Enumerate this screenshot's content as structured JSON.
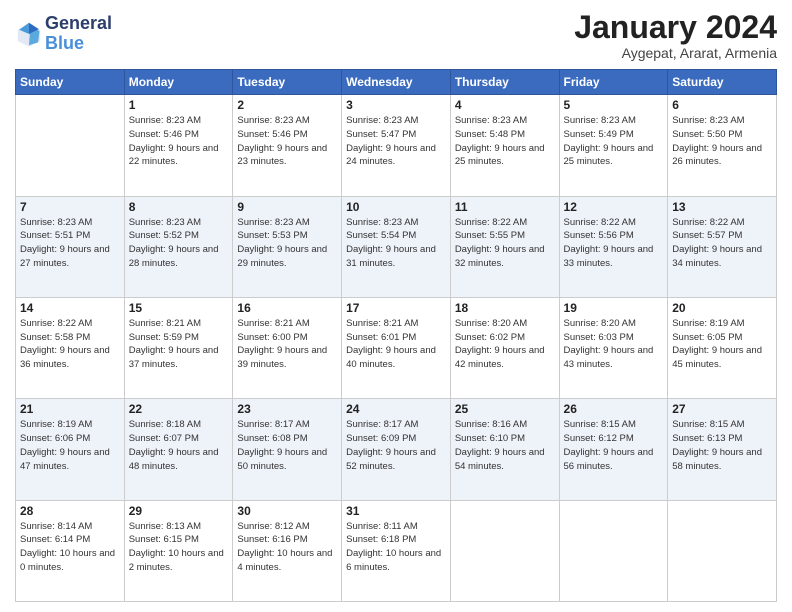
{
  "header": {
    "logo_general": "General",
    "logo_blue": "Blue",
    "month_title": "January 2024",
    "location": "Aygepat, Ararat, Armenia"
  },
  "days_of_week": [
    "Sunday",
    "Monday",
    "Tuesday",
    "Wednesday",
    "Thursday",
    "Friday",
    "Saturday"
  ],
  "weeks": [
    [
      {
        "day": null
      },
      {
        "day": "1",
        "sunrise": "Sunrise: 8:23 AM",
        "sunset": "Sunset: 5:46 PM",
        "daylight": "Daylight: 9 hours and 22 minutes."
      },
      {
        "day": "2",
        "sunrise": "Sunrise: 8:23 AM",
        "sunset": "Sunset: 5:46 PM",
        "daylight": "Daylight: 9 hours and 23 minutes."
      },
      {
        "day": "3",
        "sunrise": "Sunrise: 8:23 AM",
        "sunset": "Sunset: 5:47 PM",
        "daylight": "Daylight: 9 hours and 24 minutes."
      },
      {
        "day": "4",
        "sunrise": "Sunrise: 8:23 AM",
        "sunset": "Sunset: 5:48 PM",
        "daylight": "Daylight: 9 hours and 25 minutes."
      },
      {
        "day": "5",
        "sunrise": "Sunrise: 8:23 AM",
        "sunset": "Sunset: 5:49 PM",
        "daylight": "Daylight: 9 hours and 25 minutes."
      },
      {
        "day": "6",
        "sunrise": "Sunrise: 8:23 AM",
        "sunset": "Sunset: 5:50 PM",
        "daylight": "Daylight: 9 hours and 26 minutes."
      }
    ],
    [
      {
        "day": "7",
        "sunrise": "Sunrise: 8:23 AM",
        "sunset": "Sunset: 5:51 PM",
        "daylight": "Daylight: 9 hours and 27 minutes."
      },
      {
        "day": "8",
        "sunrise": "Sunrise: 8:23 AM",
        "sunset": "Sunset: 5:52 PM",
        "daylight": "Daylight: 9 hours and 28 minutes."
      },
      {
        "day": "9",
        "sunrise": "Sunrise: 8:23 AM",
        "sunset": "Sunset: 5:53 PM",
        "daylight": "Daylight: 9 hours and 29 minutes."
      },
      {
        "day": "10",
        "sunrise": "Sunrise: 8:23 AM",
        "sunset": "Sunset: 5:54 PM",
        "daylight": "Daylight: 9 hours and 31 minutes."
      },
      {
        "day": "11",
        "sunrise": "Sunrise: 8:22 AM",
        "sunset": "Sunset: 5:55 PM",
        "daylight": "Daylight: 9 hours and 32 minutes."
      },
      {
        "day": "12",
        "sunrise": "Sunrise: 8:22 AM",
        "sunset": "Sunset: 5:56 PM",
        "daylight": "Daylight: 9 hours and 33 minutes."
      },
      {
        "day": "13",
        "sunrise": "Sunrise: 8:22 AM",
        "sunset": "Sunset: 5:57 PM",
        "daylight": "Daylight: 9 hours and 34 minutes."
      }
    ],
    [
      {
        "day": "14",
        "sunrise": "Sunrise: 8:22 AM",
        "sunset": "Sunset: 5:58 PM",
        "daylight": "Daylight: 9 hours and 36 minutes."
      },
      {
        "day": "15",
        "sunrise": "Sunrise: 8:21 AM",
        "sunset": "Sunset: 5:59 PM",
        "daylight": "Daylight: 9 hours and 37 minutes."
      },
      {
        "day": "16",
        "sunrise": "Sunrise: 8:21 AM",
        "sunset": "Sunset: 6:00 PM",
        "daylight": "Daylight: 9 hours and 39 minutes."
      },
      {
        "day": "17",
        "sunrise": "Sunrise: 8:21 AM",
        "sunset": "Sunset: 6:01 PM",
        "daylight": "Daylight: 9 hours and 40 minutes."
      },
      {
        "day": "18",
        "sunrise": "Sunrise: 8:20 AM",
        "sunset": "Sunset: 6:02 PM",
        "daylight": "Daylight: 9 hours and 42 minutes."
      },
      {
        "day": "19",
        "sunrise": "Sunrise: 8:20 AM",
        "sunset": "Sunset: 6:03 PM",
        "daylight": "Daylight: 9 hours and 43 minutes."
      },
      {
        "day": "20",
        "sunrise": "Sunrise: 8:19 AM",
        "sunset": "Sunset: 6:05 PM",
        "daylight": "Daylight: 9 hours and 45 minutes."
      }
    ],
    [
      {
        "day": "21",
        "sunrise": "Sunrise: 8:19 AM",
        "sunset": "Sunset: 6:06 PM",
        "daylight": "Daylight: 9 hours and 47 minutes."
      },
      {
        "day": "22",
        "sunrise": "Sunrise: 8:18 AM",
        "sunset": "Sunset: 6:07 PM",
        "daylight": "Daylight: 9 hours and 48 minutes."
      },
      {
        "day": "23",
        "sunrise": "Sunrise: 8:17 AM",
        "sunset": "Sunset: 6:08 PM",
        "daylight": "Daylight: 9 hours and 50 minutes."
      },
      {
        "day": "24",
        "sunrise": "Sunrise: 8:17 AM",
        "sunset": "Sunset: 6:09 PM",
        "daylight": "Daylight: 9 hours and 52 minutes."
      },
      {
        "day": "25",
        "sunrise": "Sunrise: 8:16 AM",
        "sunset": "Sunset: 6:10 PM",
        "daylight": "Daylight: 9 hours and 54 minutes."
      },
      {
        "day": "26",
        "sunrise": "Sunrise: 8:15 AM",
        "sunset": "Sunset: 6:12 PM",
        "daylight": "Daylight: 9 hours and 56 minutes."
      },
      {
        "day": "27",
        "sunrise": "Sunrise: 8:15 AM",
        "sunset": "Sunset: 6:13 PM",
        "daylight": "Daylight: 9 hours and 58 minutes."
      }
    ],
    [
      {
        "day": "28",
        "sunrise": "Sunrise: 8:14 AM",
        "sunset": "Sunset: 6:14 PM",
        "daylight": "Daylight: 10 hours and 0 minutes."
      },
      {
        "day": "29",
        "sunrise": "Sunrise: 8:13 AM",
        "sunset": "Sunset: 6:15 PM",
        "daylight": "Daylight: 10 hours and 2 minutes."
      },
      {
        "day": "30",
        "sunrise": "Sunrise: 8:12 AM",
        "sunset": "Sunset: 6:16 PM",
        "daylight": "Daylight: 10 hours and 4 minutes."
      },
      {
        "day": "31",
        "sunrise": "Sunrise: 8:11 AM",
        "sunset": "Sunset: 6:18 PM",
        "daylight": "Daylight: 10 hours and 6 minutes."
      },
      {
        "day": null
      },
      {
        "day": null
      },
      {
        "day": null
      }
    ]
  ]
}
